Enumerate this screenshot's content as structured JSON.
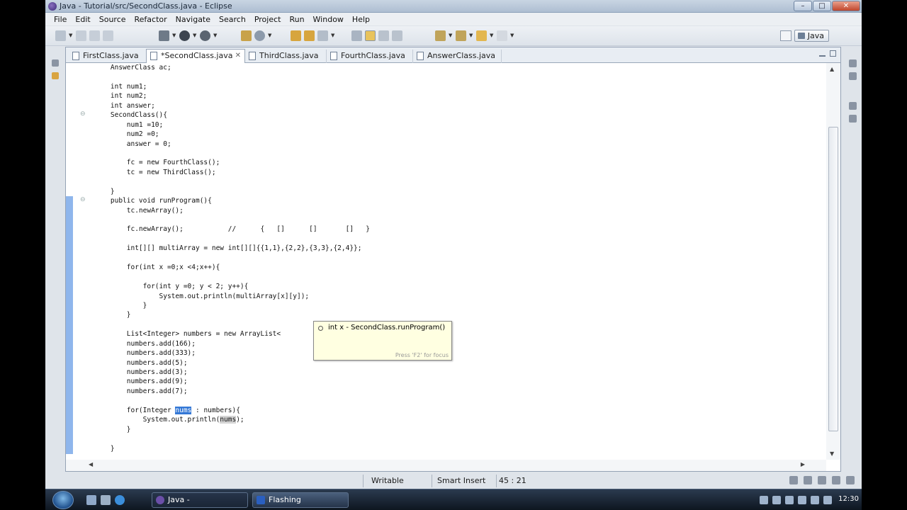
{
  "window": {
    "title": "Java - Tutorial/src/SecondClass.java - Eclipse",
    "minimize": "–",
    "maximize": "□",
    "close": "✕"
  },
  "menu": [
    "File",
    "Edit",
    "Source",
    "Refactor",
    "Navigate",
    "Search",
    "Project",
    "Run",
    "Window",
    "Help"
  ],
  "toolbar": {
    "perspective_label": "Java"
  },
  "tabs": [
    {
      "label": "FirstClass.java",
      "active": false
    },
    {
      "label": "*SecondClass.java",
      "active": true
    },
    {
      "label": "ThirdClass.java",
      "active": false
    },
    {
      "label": "FourthClass.java",
      "active": false
    },
    {
      "label": "AnswerClass.java",
      "active": false
    }
  ],
  "tab_close_glyph": "✕",
  "code": {
    "lines": [
      "    AnswerClass ac;",
      "",
      "    int num1;",
      "    int num2;",
      "    int answer;",
      "    SecondClass(){",
      "        num1 =10;",
      "        num2 =0;",
      "        answer = 0;",
      "",
      "        fc = new FourthClass();",
      "        tc = new ThirdClass();",
      "",
      "    }",
      "    public void runProgram(){",
      "        tc.newArray();",
      "",
      "        fc.newArray();           //      {   []      []       []   }",
      "",
      "        int[][] multiArray = new int[][]{{1,1},{2,2},{3,3},{2,4}};",
      "",
      "        for(int x =0;x <4;x++){",
      "",
      "            for(int y =0; y < 2; y++){",
      "                System.out.println(multiArray[x][y]);",
      "            }",
      "        }",
      "",
      "        List<Integer> numbers = new ArrayList<",
      "        numbers.add(166);",
      "        numbers.add(333);",
      "        numbers.add(5);",
      "        numbers.add(3);",
      "        numbers.add(9);",
      "        numbers.add(7);",
      "",
      "        for(Integer nums : numbers){",
      "            System.out.println(nums);",
      "        }",
      "",
      "    }"
    ],
    "selected_word": "nums"
  },
  "hover": {
    "text": "int x - SecondClass.runProgram()",
    "hint": "Press 'F2' for focus"
  },
  "status": {
    "writable": "Writable",
    "insert_mode": "Smart Insert",
    "position": "45 : 21"
  },
  "taskbar": {
    "tasks": [
      {
        "label": "Java - Tutorial/src/S...",
        "pressed": true
      },
      {
        "label": "Flashing",
        "pressed": false
      }
    ],
    "clock": "12:30"
  }
}
